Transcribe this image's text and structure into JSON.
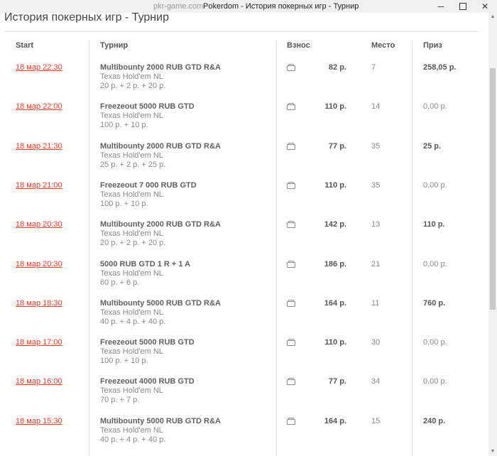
{
  "window": {
    "site": "pkr-game.com",
    "title": "Pokerdom - История покерных игр - Турнир",
    "minimize_glyph": "─",
    "close_glyph": "✕"
  },
  "page": {
    "heading": "История покерных игр - Турнир"
  },
  "table": {
    "headers": {
      "start": "Start",
      "tournament": "Турнир",
      "buyin": "Взнос",
      "place": "Место",
      "prize": "Приз"
    },
    "rows": [
      {
        "date": "18 мар 22:30",
        "name": "Multibounty 2000 RUB GTD R&A",
        "game": "Texas Hold'em NL",
        "fee": "20 р. + 2 р. + 20 р.",
        "buyin": "82 р.",
        "place": "7",
        "prize": "258,05 р.",
        "won": true
      },
      {
        "date": "18 мар 22:00",
        "name": "Freezeout 5000 RUB GTD",
        "game": "Texas Hold'em NL",
        "fee": "100 р. + 10 р.",
        "buyin": "110 р.",
        "place": "14",
        "prize": "0,00 р.",
        "won": false
      },
      {
        "date": "18 мар 21:30",
        "name": "Multibounty 2000 RUB GTD R&A",
        "game": "Texas Hold'em NL",
        "fee": "25 р. + 2 р. + 25 р.",
        "buyin": "77 р.",
        "place": "35",
        "prize": "25 р.",
        "won": true
      },
      {
        "date": "18 мар 21:00",
        "name": "Freezeout 7 000 RUB GTD",
        "game": "Texas Hold'em NL",
        "fee": "100 р. + 10 р.",
        "buyin": "110 р.",
        "place": "35",
        "prize": "0,00 р.",
        "won": false
      },
      {
        "date": "18 мар 20:30",
        "name": "Multibounty 2000 RUB GTD R&A",
        "game": "Texas Hold'em NL",
        "fee": "20 р. + 2 р. + 20 р.",
        "buyin": "142 р.",
        "place": "13",
        "prize": "110 р.",
        "won": true
      },
      {
        "date": "18 мар 20:30",
        "name": "5000 RUB GTD 1 R + 1 A",
        "game": "Texas Hold'em NL",
        "fee": "60 р. + 6 р.",
        "buyin": "186 р.",
        "place": "21",
        "prize": "0,00 р.",
        "won": false
      },
      {
        "date": "18 мар 18:30",
        "name": "Multibounty 5000 RUB GTD R&A",
        "game": "Texas Hold'em NL",
        "fee": "40 р. + 4 р. + 40 р.",
        "buyin": "164 р.",
        "place": "11",
        "prize": "760 р.",
        "won": true
      },
      {
        "date": "18 мар 17:00",
        "name": "Freezeout 5000 RUB GTD",
        "game": "Texas Hold'em NL",
        "fee": "100 р. + 10 р.",
        "buyin": "110 р.",
        "place": "30",
        "prize": "0,00 р.",
        "won": false
      },
      {
        "date": "18 мар 16:00",
        "name": "Freezeout 4000 RUB GTD",
        "game": "Texas Hold'em NL",
        "fee": "70 р. + 7 р.",
        "buyin": "77 р.",
        "place": "34",
        "prize": "0,00 р.",
        "won": false
      },
      {
        "date": "18 мар 15:30",
        "name": "Multibounty 5000 RUB GTD R&A",
        "game": "Texas Hold'em NL",
        "fee": "40 р. + 4 р. + 40 р.",
        "buyin": "164 р.",
        "place": "15",
        "prize": "240 р.",
        "won": true
      }
    ]
  },
  "colors": {
    "link": "#e2402c",
    "text": "#555555",
    "muted": "#888888"
  },
  "icons": {
    "buyin_row": "wallet-icon"
  }
}
